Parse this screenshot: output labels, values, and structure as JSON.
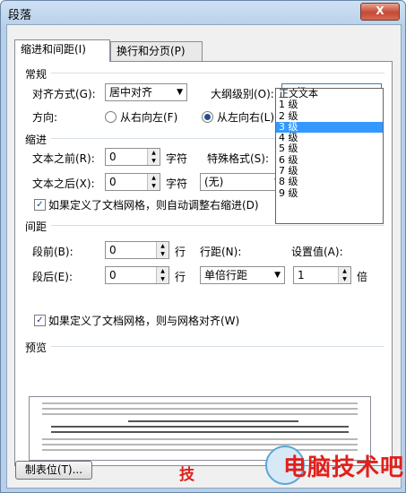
{
  "window": {
    "title": "段落",
    "close_label": "X"
  },
  "tabs": [
    {
      "label": "缩进和间距(I)",
      "active": true
    },
    {
      "label": "换行和分页(P)",
      "active": false
    }
  ],
  "general": {
    "section": "常规",
    "alignment_label": "对齐方式(G):",
    "alignment_value": "居中对齐",
    "outline_label": "大纲级别(O):",
    "outline_value": "3 级",
    "direction_label": "方向:",
    "rtl_label": "从右向左(F)",
    "ltr_label": "从左向右(L)",
    "direction_selected": "ltr"
  },
  "outline_options": [
    "正文文本",
    "1 级",
    "2 级",
    "3 级",
    "4 级",
    "5 级",
    "6 级",
    "7 级",
    "8 级",
    "9 级"
  ],
  "outline_selected_index": 3,
  "indent": {
    "section": "缩进",
    "before_label": "文本之前(R):",
    "before_value": "0",
    "before_unit": "字符",
    "after_label": "文本之后(X):",
    "after_value": "0",
    "after_unit": "字符",
    "special_label": "特殊格式(S):",
    "special_value": "(无)",
    "auto_adjust_label": "如果定义了文档网格，则自动调整右缩进(D)",
    "auto_adjust_checked": true
  },
  "spacing": {
    "section": "间距",
    "before_label": "段前(B):",
    "before_value": "0",
    "before_unit": "行",
    "after_label": "段后(E):",
    "after_value": "0",
    "after_unit": "行",
    "line_label": "行距(N):",
    "line_value": "单倍行距",
    "setting_label": "设置值(A):",
    "setting_value": "1",
    "setting_unit": "倍",
    "grid_label": "如果定义了文档网格，则与网格对齐(W)",
    "grid_checked": true
  },
  "preview": {
    "section": "预览"
  },
  "buttons": {
    "tabs_label": "制表位(T)..."
  },
  "watermark": {
    "text": "电脑技术吧",
    "left_text": "技"
  },
  "colors": {
    "accent": "#3399ff",
    "watermark": "#e0201c",
    "title_bar": "#b7cfe9"
  }
}
